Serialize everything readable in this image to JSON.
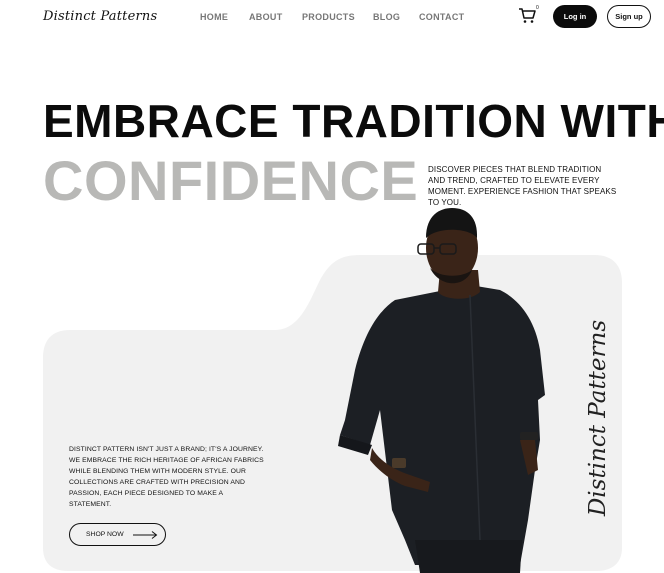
{
  "brand": {
    "logo_text": "Distinct Patterns",
    "vertical_text": "Distinct Patterns"
  },
  "nav": {
    "links": [
      "HOME",
      "ABOUT",
      "PRODUCTS",
      "BLOG",
      "CONTACT"
    ],
    "cart_count": "0",
    "cart_icon": "cart-icon",
    "login_label": "Log in",
    "signup_label": "Sign up"
  },
  "hero": {
    "headline_line1": "EMBRACE TRADITION WITH",
    "headline_line2": "CONFIDENCE",
    "intro_text": "DISCOVER PIECES THAT BLEND TRADITION AND TREND, CRAFTED TO ELEVATE EVERY MOMENT. EXPERIENCE FASHION THAT SPEAKS TO YOU.",
    "body_text": "DISTINCT PATTERN ISN'T JUST A BRAND; IT'S A JOURNEY. WE EMBRACE THE RICH HERITAGE OF AFRICAN FABRICS WHILE BLENDING THEM WITH MODERN STYLE. OUR COLLECTIONS ARE CRAFTED WITH PRECISION AND PASSION, EACH PIECE DESIGNED TO MAKE A STATEMENT.",
    "shop_button": "SHOP NOW",
    "shop_icon": "arrow-right-icon"
  },
  "colors": {
    "headline_dark": "#0b0b0b",
    "headline_grey": "#b8b8b6",
    "panel_grey": "#f1f1f1",
    "button_dark": "#0b0b0b"
  }
}
